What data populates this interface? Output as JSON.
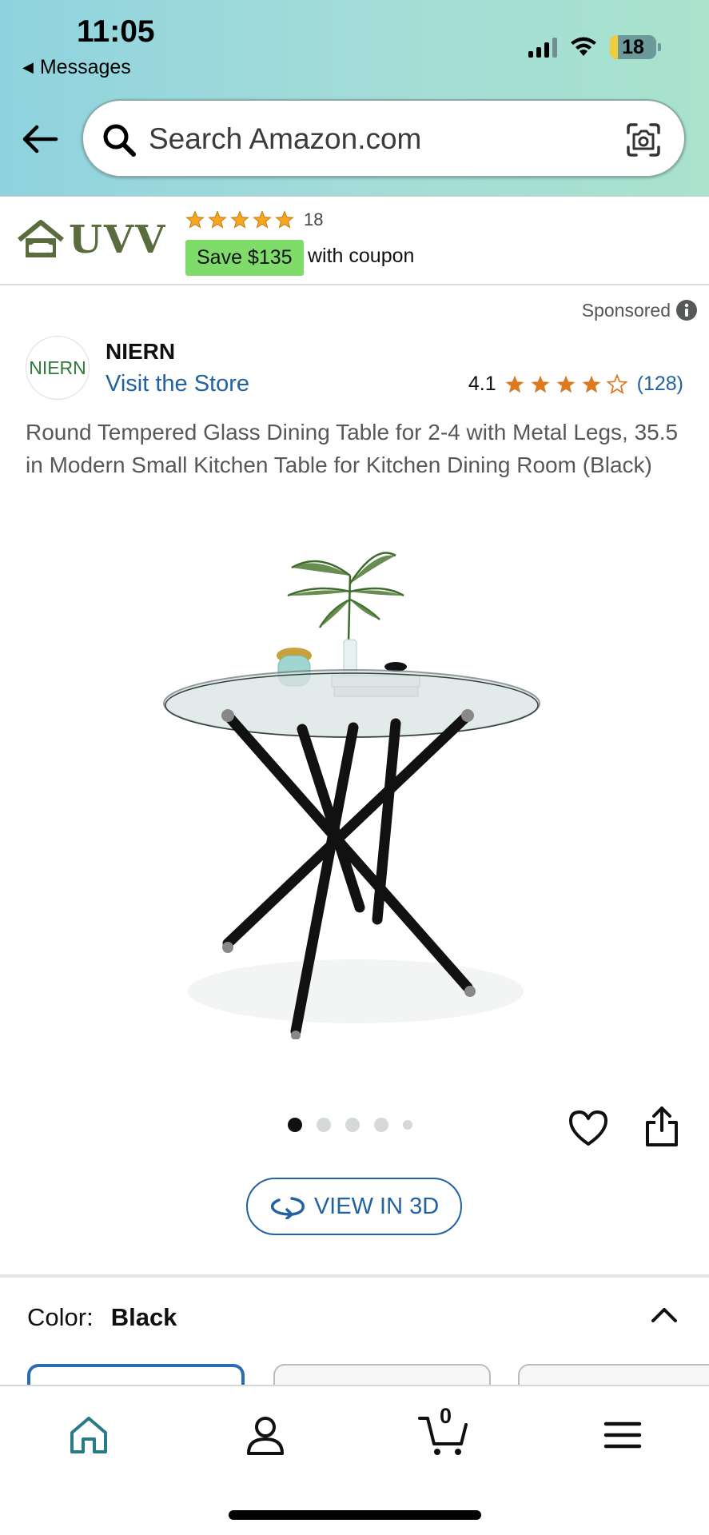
{
  "status_bar": {
    "time": "11:05",
    "back_app": "Messages",
    "battery": "18",
    "battery_level": 0.18
  },
  "header": {
    "search_placeholder": "Search Amazon.com",
    "icons": [
      "back-arrow-icon",
      "search-icon",
      "camera-icon"
    ]
  },
  "sponsored_banner": {
    "brand_logo_text": "UVV",
    "rating_stars": 5,
    "rating_count": "18",
    "coupon_label": "Save $135",
    "coupon_suffix": "with coupon"
  },
  "product": {
    "sponsored_label": "Sponsored",
    "brand_logo_text": "NIERN",
    "brand_name": "NIERN",
    "visit_store": "Visit the Store",
    "rating": "4.1",
    "rating_stars": 4.1,
    "review_count": "(128)",
    "title": "Round Tempered Glass Dining Table for 2-4 with Metal Legs, 35.5 in Modern Small Kitchen Table for Kitchen Dining Room (Black)"
  },
  "gallery": {
    "image_count": 5,
    "active_index": 0,
    "view_3d_label": "VIEW IN 3D"
  },
  "variations": {
    "color_label": "Color:",
    "color_value": "Black"
  },
  "bottom_nav": {
    "items": [
      "home-icon",
      "account-icon",
      "cart-icon",
      "menu-icon"
    ],
    "cart_count": "0"
  },
  "colors": {
    "header_gradient_start": "#8fd3df",
    "header_gradient_end": "#a9e3cd",
    "link_blue": "#2162a1",
    "star_orange": "#de7921",
    "coupon_green": "#7fdc6a",
    "brand_green": "#2f7a3b"
  }
}
